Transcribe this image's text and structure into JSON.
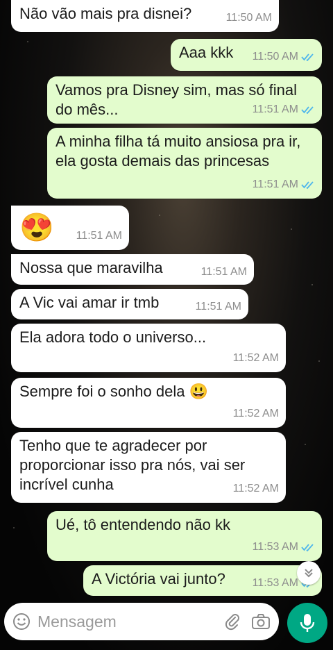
{
  "messages": [
    {
      "dir": "in",
      "text": "Não vão mais pra disnei?",
      "time": "11:50 AM"
    },
    {
      "dir": "out",
      "text": "Aaa kkk",
      "time": "11:50 AM"
    },
    {
      "dir": "out",
      "text": "Vamos pra Disney sim, mas só final do mês...",
      "time": "11:51 AM"
    },
    {
      "dir": "out",
      "text": "A minha filha tá muito ansiosa pra ir, ela gosta demais das princesas",
      "time": "11:51 AM"
    },
    {
      "dir": "in",
      "text": "😍",
      "time": "11:51 AM"
    },
    {
      "dir": "in",
      "text": "Nossa que maravilha",
      "time": "11:51 AM"
    },
    {
      "dir": "in",
      "text": "A Vic vai amar ir tmb",
      "time": "11:51 AM"
    },
    {
      "dir": "in",
      "text": "Ela adora todo o universo...",
      "time": "11:52 AM"
    },
    {
      "dir": "in",
      "text": "Sempre foi o sonho dela",
      "emoji": "😃",
      "time": "11:52 AM"
    },
    {
      "dir": "in",
      "text": "Tenho que te agradecer por proporcionar isso pra nós, vai ser incrível cunha",
      "time": "11:52 AM"
    },
    {
      "dir": "out",
      "text": "Ué, tô entendendo não kk",
      "time": "11:53 AM"
    },
    {
      "dir": "out",
      "text": "A Victória vai junto?",
      "time": "11:53 AM"
    }
  ],
  "composer": {
    "placeholder": "Mensagem"
  },
  "icons": {
    "emoji": "emoji-icon",
    "attach": "paperclip-icon",
    "camera": "camera-icon",
    "mic": "mic-icon",
    "scroll": "chevrons-down-icon",
    "read": "double-check-icon"
  },
  "colors": {
    "incoming": "#ffffff",
    "outgoing": "#e3fccd",
    "accent": "#00a884",
    "read_ticks": "#4fb6ec"
  }
}
